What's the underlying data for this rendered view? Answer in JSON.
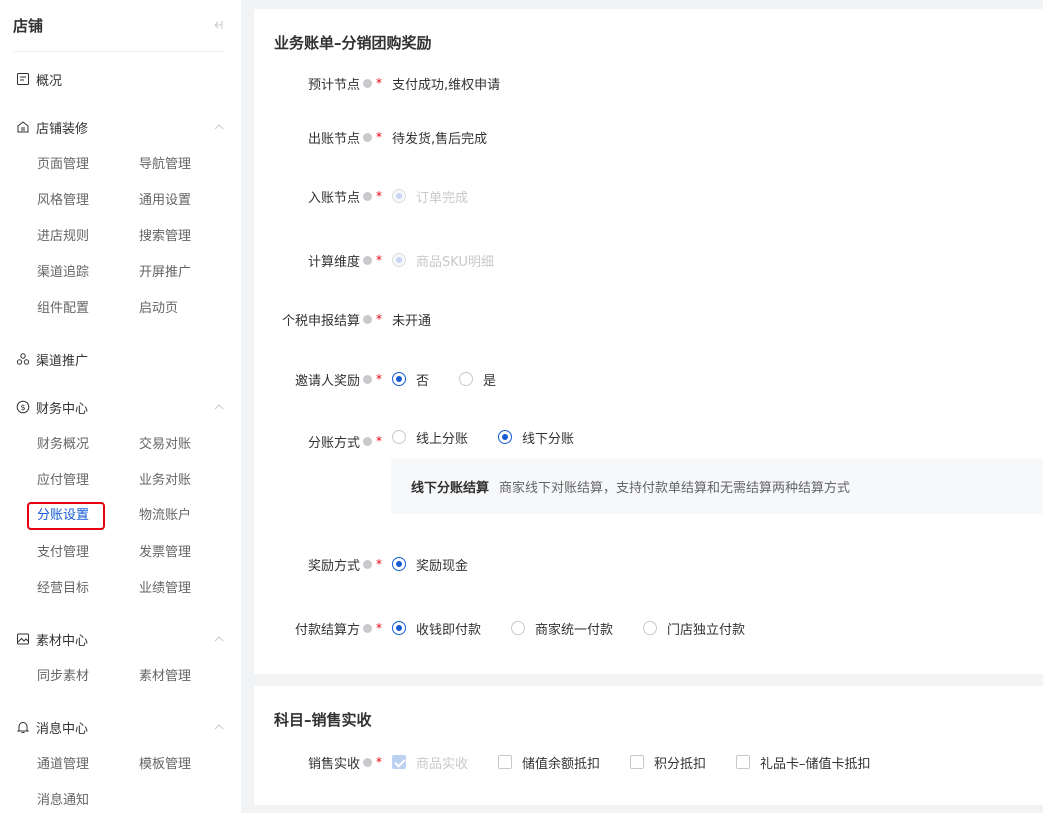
{
  "sidebar": {
    "title": "店铺",
    "groups": {
      "overview": {
        "label": "概况",
        "icon": "overview-icon"
      },
      "decoration": {
        "label": "店铺装修",
        "icon": "store-icon",
        "items": [
          "页面管理",
          "导航管理",
          "风格管理",
          "通用设置",
          "进店规则",
          "搜索管理",
          "渠道追踪",
          "开屏推广",
          "组件配置",
          "启动页"
        ]
      },
      "channel": {
        "label": "渠道推广",
        "icon": "channel-icon"
      },
      "finance": {
        "label": "财务中心",
        "icon": "dollar-icon",
        "items": [
          "财务概况",
          "交易对账",
          "应付管理",
          "业务对账",
          "分账设置",
          "物流账户",
          "支付管理",
          "发票管理",
          "经营目标",
          "业绩管理"
        ]
      },
      "material": {
        "label": "素材中心",
        "icon": "image-icon",
        "items": [
          "同步素材",
          "素材管理"
        ]
      },
      "message": {
        "label": "消息中心",
        "icon": "bell-icon",
        "items": [
          "通道管理",
          "模板管理",
          "消息通知"
        ]
      }
    },
    "active_item": "分账设置"
  },
  "section1": {
    "title": "业务账单–分销团购奖励",
    "rows": {
      "forecast_node": {
        "label": "预计节点",
        "value": "支付成功,维权申请"
      },
      "billing_node": {
        "label": "出账节点",
        "value": "待发货,售后完成"
      },
      "entry_node": {
        "label": "入账节点",
        "option": "订单完成"
      },
      "calc_dimension": {
        "label": "计算维度",
        "option": "商品SKU明细"
      },
      "tax": {
        "label": "个税申报结算",
        "value": "未开通"
      },
      "inviter_reward": {
        "label": "邀请人奖励",
        "options": [
          "否",
          "是"
        ],
        "selected": "否"
      },
      "split_method": {
        "label": "分账方式",
        "options": [
          "线上分账",
          "线下分账"
        ],
        "selected": "线下分账"
      },
      "reward_method": {
        "label": "奖励方式",
        "options": [
          "奖励现金"
        ],
        "selected": "奖励现金"
      },
      "payment_settlement": {
        "label": "付款结算方",
        "options": [
          "收钱即付款",
          "商家统一付款",
          "门店独立付款"
        ],
        "selected": "收钱即付款"
      }
    },
    "note": {
      "title": "线下分账结算",
      "desc": "商家线下对账结算，支持付款单结算和无需结算两种结算方式"
    }
  },
  "section2": {
    "title": "科目–销售实收",
    "row": {
      "label": "销售实收",
      "options": [
        "商品实收",
        "储值余额抵扣",
        "积分抵扣",
        "礼品卡–储值卡抵扣"
      ],
      "checked": [
        "商品实收"
      ]
    }
  },
  "colors": {
    "primary": "#155bd4",
    "required": "#e60012",
    "highlight_border": "#e60012"
  }
}
